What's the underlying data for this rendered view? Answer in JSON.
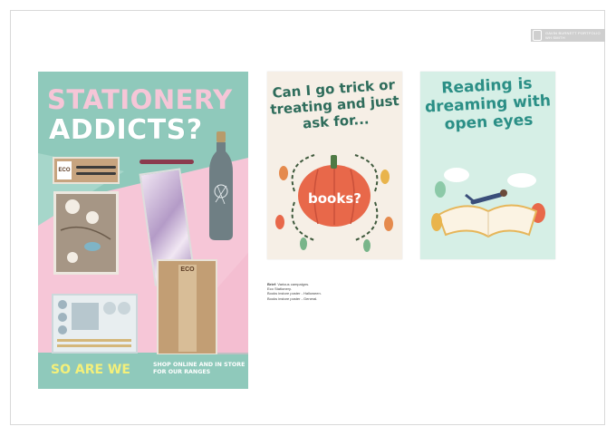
{
  "badge": {
    "line1": "GAVIN BURNETT PORTFOLIO",
    "line2": "WH SMITH"
  },
  "poster1": {
    "title_line1": "STATIONERY",
    "title_line2": "ADDICTS?",
    "footer_left": "SO ARE WE",
    "footer_right": "SHOP ONLINE AND IN STORE FOR OUR RANGES",
    "eco_label_1": "ECO",
    "eco_label_2": "ECO"
  },
  "poster2": {
    "headline": "Can I go trick or treating and just ask for...",
    "pumpkin_text": "books?"
  },
  "poster3": {
    "headline": "Reading is dreaming with open eyes"
  },
  "brief": {
    "label": "Brief",
    "text": ": Various campaigns.",
    "lines": [
      "Eco Stationery.",
      "Books instore poster - Halloween.",
      "Books instore poster - General."
    ]
  },
  "colors": {
    "mint": "#8fc9bb",
    "pink": "#f6c6d7",
    "yellow": "#f4f07a",
    "teal_text": "#2b8f86",
    "pumpkin": "#e8684a"
  }
}
